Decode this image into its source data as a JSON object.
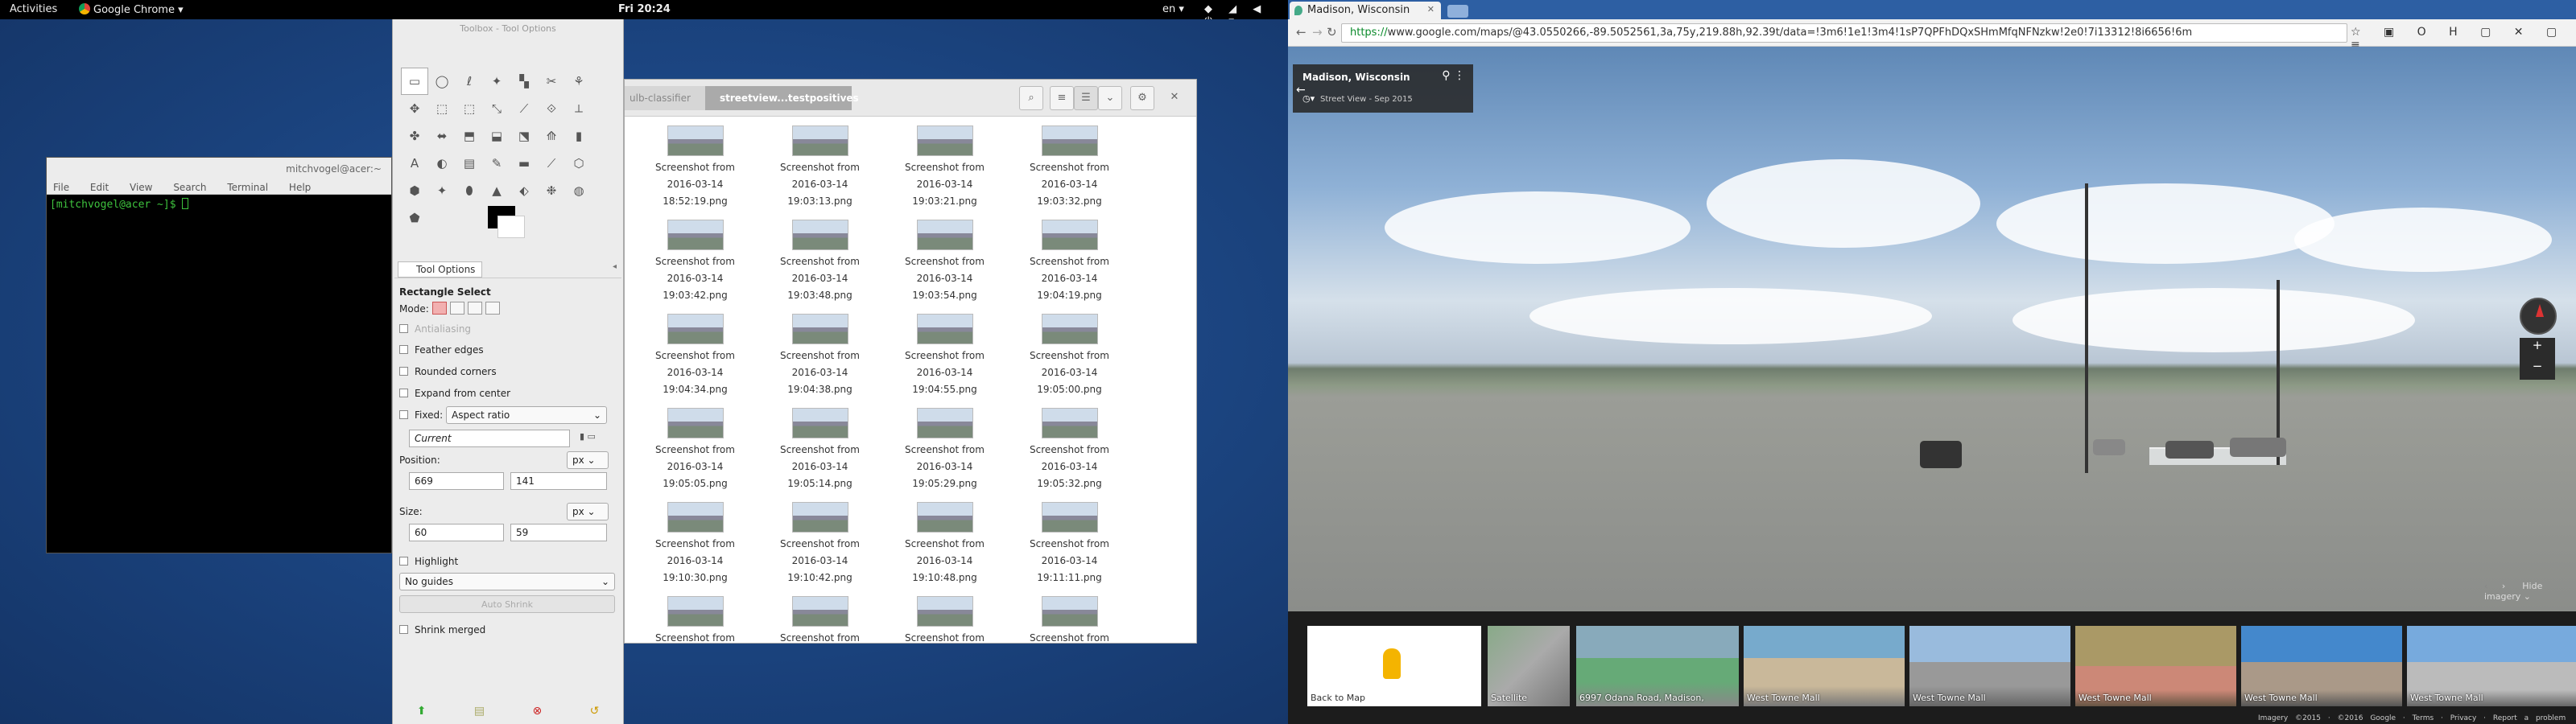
{
  "gnome": {
    "activities": "Activities",
    "app_menu": "Google Chrome ▾",
    "clock": "Fri 20:24",
    "lang": "en ▾",
    "tray": "◆ ◢ ◀ ⏻ ▾"
  },
  "terminal": {
    "title": "mitchvogel@acer:~",
    "menu": [
      "File",
      "Edit",
      "View",
      "Search",
      "Terminal",
      "Help"
    ],
    "prompt": "[mitchvogel@acer ~]$ "
  },
  "toolbox": {
    "title": "Toolbox - Tool Options",
    "tool_icons": [
      "▭",
      "◯",
      "ℓ",
      "✦",
      "▚",
      "✂",
      "⚘",
      "✥",
      "⬚",
      "⬚",
      "⤡",
      "⟋",
      "⟐",
      "⟂",
      "✤",
      "⬌",
      "⬒",
      "⬓",
      "⬔",
      "⟰",
      "▮",
      "A",
      "◐",
      "▤",
      "✎",
      "▬",
      "⟋",
      "⬡",
      "⬢",
      "✦",
      "⬮",
      "▲",
      "⬖",
      "❉",
      "◍",
      "⬟"
    ],
    "tab_label": "Tool Options",
    "tool_name": "Rectangle Select",
    "mode_label": "Mode:",
    "antialiasing": "Antialiasing",
    "feather": "Feather edges",
    "rounded": "Rounded corners",
    "expand": "Expand from center",
    "fixed": "Fixed:",
    "fixed_value": "Aspect ratio",
    "current": "Current",
    "position_label": "Position:",
    "position_unit": "px",
    "pos_x": "669",
    "pos_y": "141",
    "size_label": "Size:",
    "size_unit": "px",
    "size_w": "60",
    "size_h": "59",
    "highlight": "Highlight",
    "guides": "No guides",
    "auto_shrink": "Auto Shrink",
    "shrink_merged": "Shrink merged"
  },
  "files": {
    "tab1": "ulb-classifier",
    "tab2": "streetview...testpositives",
    "items": [
      [
        "Screenshot from",
        "2016-03-14",
        "18:52:19.png"
      ],
      [
        "Screenshot from",
        "2016-03-14",
        "19:03:13.png"
      ],
      [
        "Screenshot from",
        "2016-03-14",
        "19:03:21.png"
      ],
      [
        "Screenshot from",
        "2016-03-14",
        "19:03:32.png"
      ],
      [
        "Screenshot from",
        "2016-03-14",
        "19:03:42.png"
      ],
      [
        "Screenshot from",
        "2016-03-14",
        "19:03:48.png"
      ],
      [
        "Screenshot from",
        "2016-03-14",
        "19:03:54.png"
      ],
      [
        "Screenshot from",
        "2016-03-14",
        "19:04:19.png"
      ],
      [
        "Screenshot from",
        "2016-03-14",
        "19:04:34.png"
      ],
      [
        "Screenshot from",
        "2016-03-14",
        "19:04:38.png"
      ],
      [
        "Screenshot from",
        "2016-03-14",
        "19:04:55.png"
      ],
      [
        "Screenshot from",
        "2016-03-14",
        "19:05:00.png"
      ],
      [
        "Screenshot from",
        "2016-03-14",
        "19:05:05.png"
      ],
      [
        "Screenshot from",
        "2016-03-14",
        "19:05:14.png"
      ],
      [
        "Screenshot from",
        "2016-03-14",
        "19:05:29.png"
      ],
      [
        "Screenshot from",
        "2016-03-14",
        "19:05:32.png"
      ],
      [
        "Screenshot from",
        "2016-03-14",
        "19:10:30.png"
      ],
      [
        "Screenshot from",
        "2016-03-14",
        "19:10:42.png"
      ],
      [
        "Screenshot from",
        "2016-03-14",
        "19:10:48.png"
      ],
      [
        "Screenshot from",
        "2016-03-14",
        "19:11:11.png"
      ],
      [
        "Screenshot from",
        "",
        ""
      ],
      [
        "Screenshot from",
        "",
        ""
      ],
      [
        "Screenshot from",
        "",
        ""
      ],
      [
        "Screenshot from",
        "",
        ""
      ]
    ]
  },
  "chrome": {
    "tab_title": "Madison, Wisconsin",
    "url_secure": "https://",
    "url": "www.google.com/maps/@43.0550266,-89.5052561,3a,75y,219.88h,92.39t/data=!3m6!1e1!3m4!1sP7QPFhDQxSHmMfqNFNzkw!2e0!7i13312!8i6656!6m",
    "ext_icons": "☆ ▣ O H ▢ ✕ ▢ ≡",
    "place": "Madison, Wisconsin",
    "date": "Street View - Sep 2015",
    "hide_imagery": "Hide imagery",
    "back_to_map": "Back to Map",
    "thumbs": [
      "Satellite",
      "6997 Odana Road, Madison,",
      "West Towne Mall",
      "West Towne Mall",
      "West Towne Mall",
      "West Towne Mall",
      "West Towne Mall"
    ],
    "footer": "Imagery ©2015 · ©2016 Google · Terms · Privacy · Report a problem"
  }
}
